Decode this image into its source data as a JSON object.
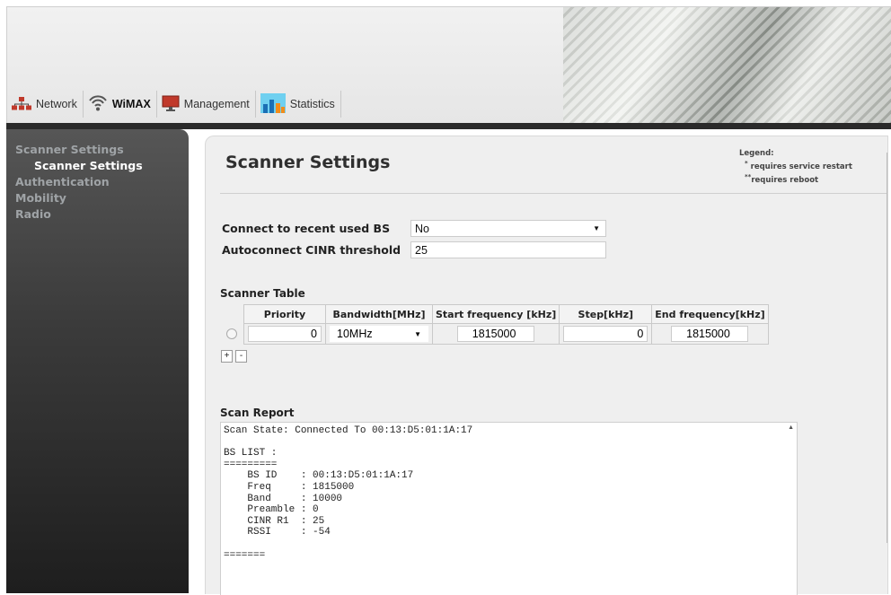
{
  "tabs": [
    {
      "label": "Network"
    },
    {
      "label": "WiMAX"
    },
    {
      "label": "Management"
    },
    {
      "label": "Statistics"
    }
  ],
  "sidebar": {
    "items": [
      {
        "label": "Scanner Settings"
      },
      {
        "label": "Scanner Settings"
      },
      {
        "label": "Authentication"
      },
      {
        "label": "Mobility"
      },
      {
        "label": "Radio"
      }
    ]
  },
  "page": {
    "title": "Scanner Settings",
    "legend_title": "Legend:",
    "legend_restart_mark": "*",
    "legend_restart": "requires service restart",
    "legend_reboot_mark": "**",
    "legend_reboot": "requires reboot"
  },
  "form": {
    "connect_recent_label": "Connect to recent used BS",
    "connect_recent_value": "No",
    "cinr_label": "Autoconnect CINR threshold",
    "cinr_value": "25"
  },
  "scanner_table": {
    "title": "Scanner Table",
    "headers": [
      "Priority",
      "Bandwidth[MHz]",
      "Start frequency [kHz]",
      "Step[kHz]",
      "End frequency[kHz]"
    ],
    "rows": [
      {
        "priority": "0",
        "bandwidth": "10MHz",
        "start": "1815000",
        "step": "0",
        "end": "1815000"
      }
    ],
    "add_label": "+",
    "remove_label": "-"
  },
  "scan_report": {
    "title": "Scan Report",
    "text": "Scan State: Connected To 00:13:D5:01:1A:17\n\nBS LIST :\n=========\n    BS ID    : 00:13:D5:01:1A:17\n    Freq     : 1815000\n    Band     : 10000\n    Preamble : 0\n    CINR R1  : 25\n    RSSI     : -54\n\n======="
  },
  "colors": {
    "sidebar_bg": "#1e1e1e",
    "panel_bg": "#efefef"
  }
}
